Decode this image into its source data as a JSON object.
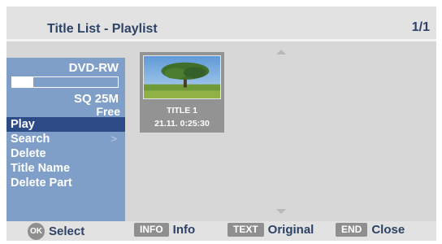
{
  "header": {
    "title": "Title List - Playlist",
    "page_indicator": "1/1"
  },
  "sidebar": {
    "disc_type": "DVD-RW",
    "capacity_used_fraction": 0.2,
    "quality": "SQ 25M",
    "free_label": "Free",
    "menu": {
      "selected_index": 0,
      "items": [
        {
          "label": "Play"
        },
        {
          "label": "Search",
          "submenu_arrow": ">"
        },
        {
          "label": "Delete"
        },
        {
          "label": "Title Name"
        },
        {
          "label": "Delete Part"
        }
      ]
    }
  },
  "titles": [
    {
      "name": "TITLE 1",
      "date_time": "21.11.  0:25:30"
    }
  ],
  "footer": {
    "ok": {
      "key": "OK",
      "label": "Select"
    },
    "info": {
      "key": "INFO",
      "label": "Info"
    },
    "text": {
      "key": "TEXT",
      "label": "Original"
    },
    "end": {
      "key": "END",
      "label": "Close"
    }
  },
  "colors": {
    "panel": "#7f9fc8",
    "selected": "#2d4b86",
    "title_text": "#2c4366",
    "background": "#e2e2e2"
  }
}
